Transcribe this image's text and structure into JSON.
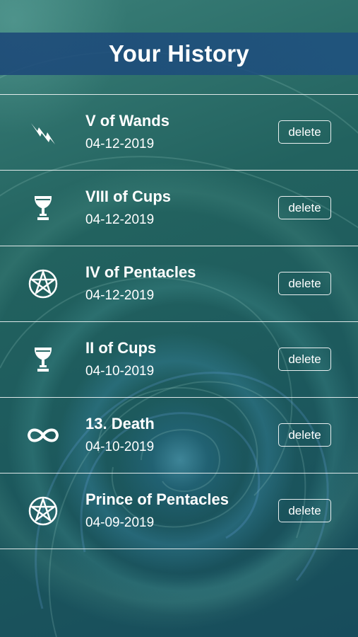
{
  "header": {
    "title": "Your History"
  },
  "history": [
    {
      "name": "V of Wands",
      "date": "04-12-2019",
      "icon": "lightning-icon",
      "delete_label": "delete"
    },
    {
      "name": "VIII of Cups",
      "date": "04-12-2019",
      "icon": "chalice-icon",
      "delete_label": "delete"
    },
    {
      "name": "IV of Pentacles",
      "date": "04-12-2019",
      "icon": "pentacle-icon",
      "delete_label": "delete"
    },
    {
      "name": "II of Cups",
      "date": "04-10-2019",
      "icon": "chalice-icon",
      "delete_label": "delete"
    },
    {
      "name": "13. Death",
      "date": "04-10-2019",
      "icon": "infinity-icon",
      "delete_label": "delete"
    },
    {
      "name": "Prince of Pentacles",
      "date": "04-09-2019",
      "icon": "pentacle-icon",
      "delete_label": "delete"
    }
  ],
  "colors": {
    "background": "#1f5d5e",
    "header_band": "#1e4f80",
    "text": "#ffffff"
  }
}
